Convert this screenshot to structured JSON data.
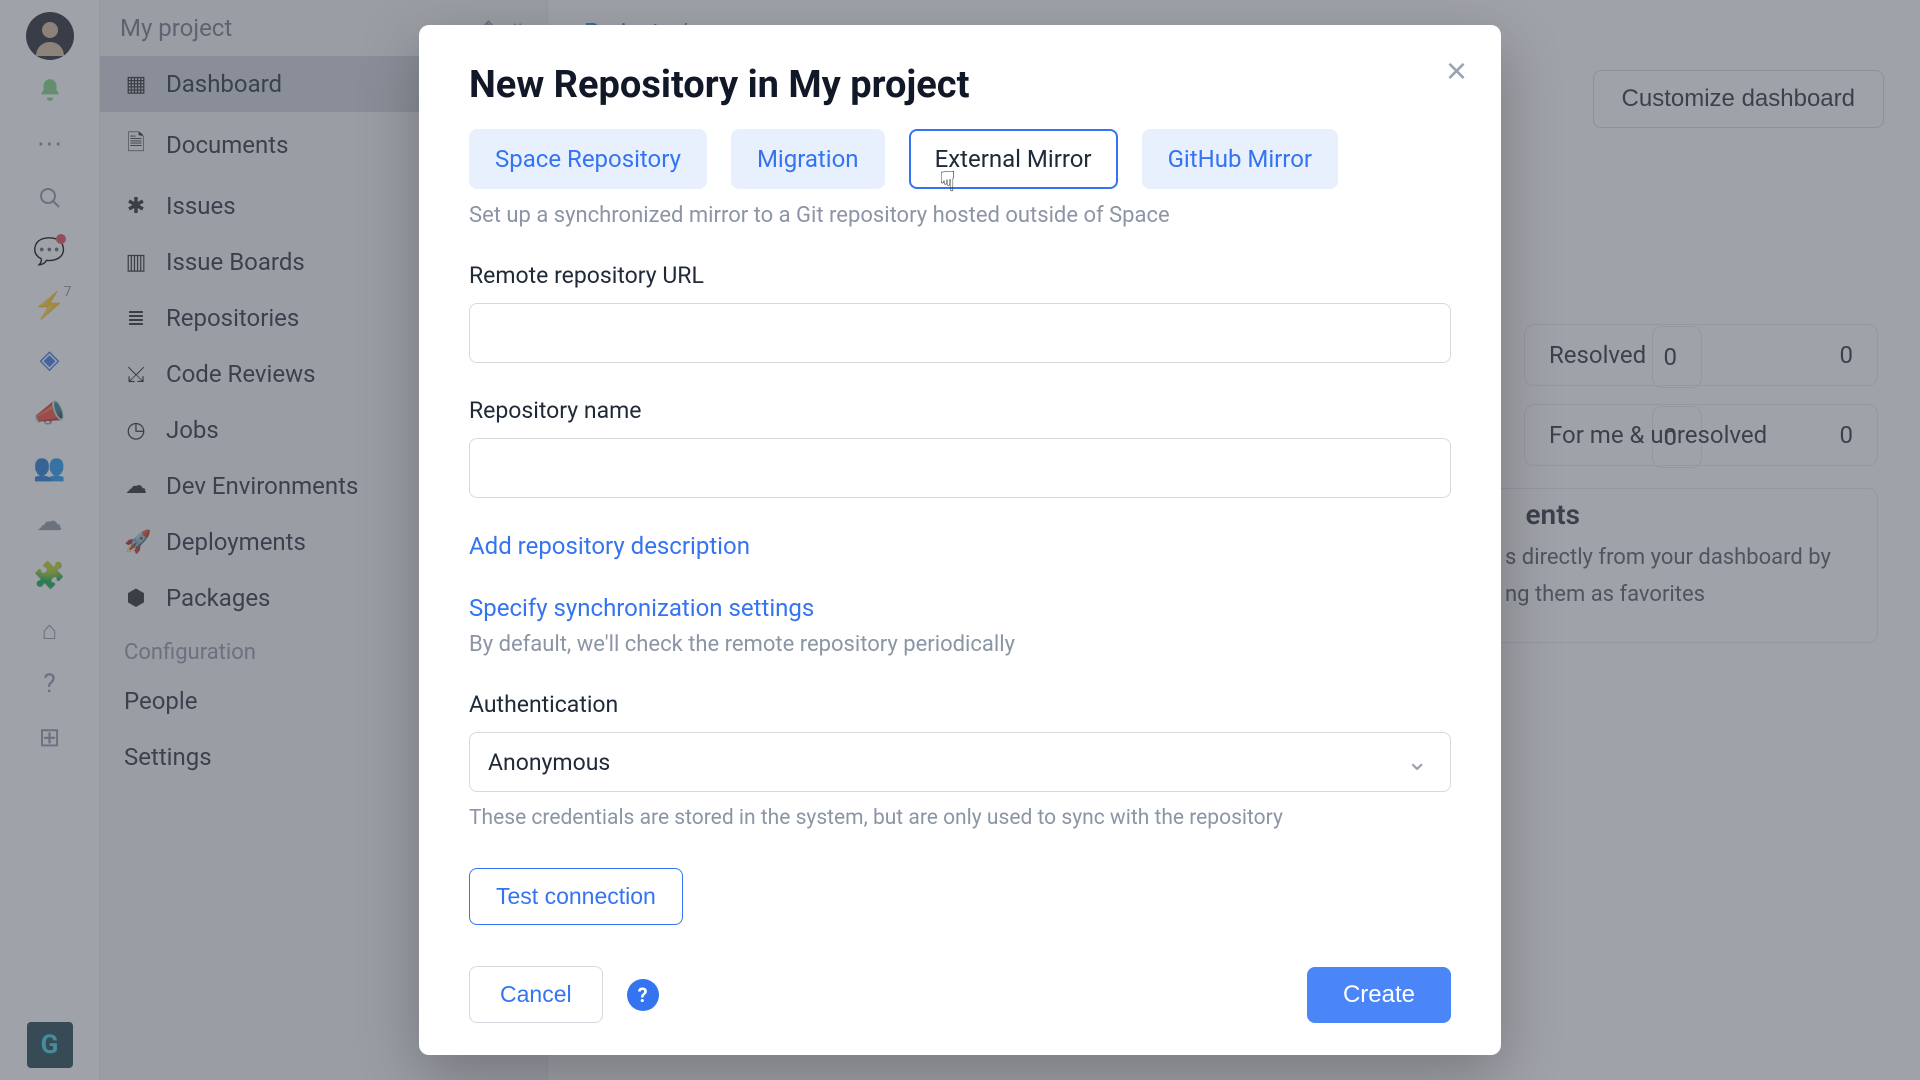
{
  "iconbar": {
    "notif_count": "7"
  },
  "sidebar": {
    "title": "My project",
    "items": [
      {
        "icon": "▦",
        "label": "Dashboard"
      },
      {
        "icon": "🗎",
        "label": "Documents"
      },
      {
        "icon": "✱",
        "label": "Issues"
      },
      {
        "icon": "▥",
        "label": "Issue Boards"
      },
      {
        "icon": "≣",
        "label": "Repositories"
      },
      {
        "icon": "⤩",
        "label": "Code Reviews"
      },
      {
        "icon": "◷",
        "label": "Jobs"
      },
      {
        "icon": "☁",
        "label": "Dev Environments"
      },
      {
        "icon": "🚀",
        "label": "Deployments"
      },
      {
        "icon": "⬢",
        "label": "Packages"
      }
    ],
    "section_label": "Configuration",
    "config_items": [
      "People",
      "Settings"
    ]
  },
  "breadcrumb": {
    "projects": "Projects",
    "sep": "/"
  },
  "main": {
    "customize": "Customize dashboard"
  },
  "cards": {
    "row1_label": "Resolved",
    "row1_val": "0",
    "row2_label": "For me & unresolved",
    "row2_val": "0",
    "leftcol1_val": "0",
    "leftcol2_val": "0",
    "doc_title": "ents",
    "doc_text": "s directly from your dashboard by ng them as favorites"
  },
  "modal": {
    "title": "New Repository in My project",
    "tabs": [
      "Space Repository",
      "Migration",
      "External Mirror",
      "GitHub Mirror"
    ],
    "active_tab": 2,
    "desc": "Set up a synchronized mirror to a Git repository hosted outside of Space",
    "remote_url_label": "Remote repository URL",
    "remote_url_value": "",
    "repo_name_label": "Repository name",
    "repo_name_value": "",
    "add_desc_link": "Add repository description",
    "sync_link": "Specify synchronization settings",
    "sync_desc": "By default, we'll check the remote repository periodically",
    "auth_label": "Authentication",
    "auth_value": "Anonymous",
    "cred_note": "These credentials are stored in the system, but are only used to sync with the repository",
    "test_connection": "Test connection",
    "cancel": "Cancel",
    "help": "?",
    "create": "Create"
  }
}
